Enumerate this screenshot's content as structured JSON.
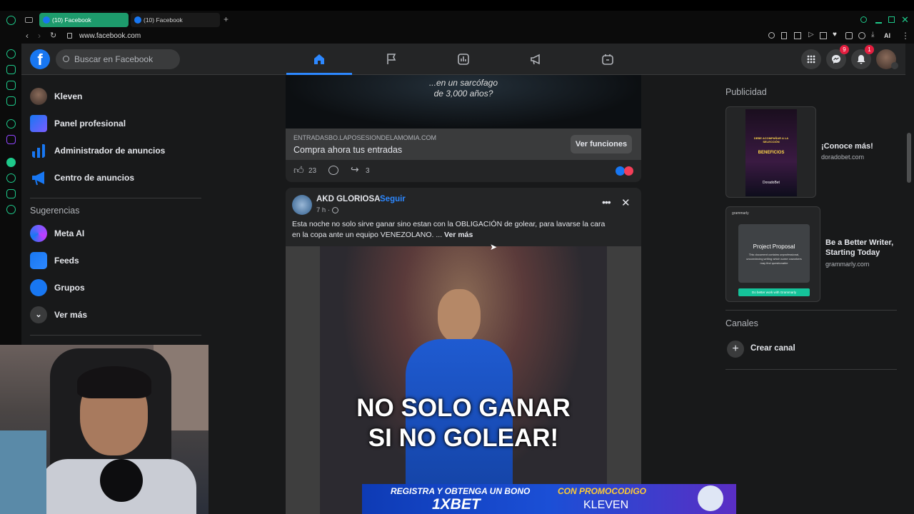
{
  "browser": {
    "tabs": [
      {
        "label": "(10) Facebook",
        "active": true
      },
      {
        "label": "(10) Facebook",
        "active": false
      }
    ],
    "new_tab": "+",
    "url": "www.facebook.com",
    "ai_label": "AI"
  },
  "header": {
    "logo": "f",
    "search_placeholder": "Buscar en Facebook",
    "messenger_badge": "9",
    "notifications_badge": "1",
    "nav_icons": [
      "home-icon",
      "flag-icon",
      "dashboard-icon",
      "megaphone-icon",
      "gaming-icon"
    ]
  },
  "sidebar": {
    "items": [
      {
        "label": "Kleven",
        "icon": "avatar"
      },
      {
        "label": "Panel profesional",
        "icon": "dashboard-icon"
      },
      {
        "label": "Administrador de anuncios",
        "icon": "chart-icon"
      },
      {
        "label": "Centro de anuncios",
        "icon": "megaphone-icon"
      }
    ],
    "suggestions_title": "Sugerencias",
    "suggestions": [
      {
        "label": "Meta AI",
        "icon": "meta-ai-icon"
      },
      {
        "label": "Feeds",
        "icon": "feeds-icon"
      },
      {
        "label": "Grupos",
        "icon": "groups-icon"
      },
      {
        "label": "Ver más",
        "icon": "chevron-down-icon"
      }
    ]
  },
  "ad_post": {
    "image_caption_line1": "...en un sarcófago",
    "image_caption_line2": "de 3,000 años?",
    "domain": "ENTRADASBO.LAPOSESIONDELAMOMIA.COM",
    "headline": "Compra ahora tus entradas",
    "cta": "Ver funciones",
    "likes": "23",
    "shares": "3"
  },
  "post": {
    "author": "AKD GLORIOSA",
    "follow": "Seguir",
    "separator": "·",
    "time": "7 h ·",
    "text_line1": "Esta noche no solo sirve ganar sino estan con la OBLIGACIÓN de golear, para lavarse la cara",
    "text_line2": "en la copa ante un equipo VENEZOLANO. ...",
    "see_more": "Ver más",
    "image_text_line1": "NO SOLO GANAR",
    "image_text_line2": "SI NO GOLEAR!"
  },
  "right": {
    "ads_title": "Publicidad",
    "ads": [
      {
        "title": "¡Conoce más!",
        "domain": "doradobet.com",
        "thumb_text": [
          "DEBE ACOMPAÑAR A LA SELECCIÓN",
          "BENEFICIOS",
          "DoradoBet"
        ]
      },
      {
        "title": "Be a Better Writer, Starting Today",
        "domain": "grammarly.com",
        "thumb_brand": "grammarly",
        "thumb_heading": "Project Proposal",
        "thumb_body": "This document contains unprofessional, unconvincing writing which some coworkers may find questionable",
        "thumb_cta": "Do better work with Grammarly"
      }
    ],
    "channels_title": "Canales",
    "create_channel": "Crear canal"
  },
  "overlay": {
    "promo_left": "REGISTRA Y OBTENGA UN BONO",
    "promo_brand": "1XBET",
    "promo_right": "CON PROMOCODIGO",
    "promo_code": "KLEVEN"
  },
  "colors": {
    "fb_blue": "#1877f2",
    "accent_link": "#2d88ff",
    "surface": "#242526",
    "background": "#18191a"
  }
}
